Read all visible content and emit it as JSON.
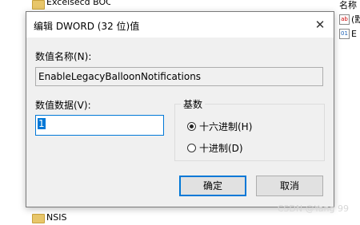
{
  "background": {
    "tree_items": [
      "Excelsecd BOCNET",
      "NSIS"
    ],
    "right_header": "名称",
    "right_items": [
      {
        "icon": "ab",
        "label": "(默"
      },
      {
        "icon": "01",
        "label": "E"
      }
    ]
  },
  "dialog": {
    "title": "编辑 DWORD (32 位)值",
    "value_name_label": "数值名称(N):",
    "value_name": "EnableLegacyBalloonNotifications",
    "value_data_label": "数值数据(V):",
    "value_data": "1",
    "base_label": "基数",
    "base_options": [
      {
        "label": "十六进制(H)",
        "checked": true
      },
      {
        "label": "十进制(D)",
        "checked": false
      }
    ],
    "ok_label": "确定",
    "cancel_label": "取消",
    "close_symbol": "✕"
  },
  "watermark": "CSDN @Yang 99"
}
